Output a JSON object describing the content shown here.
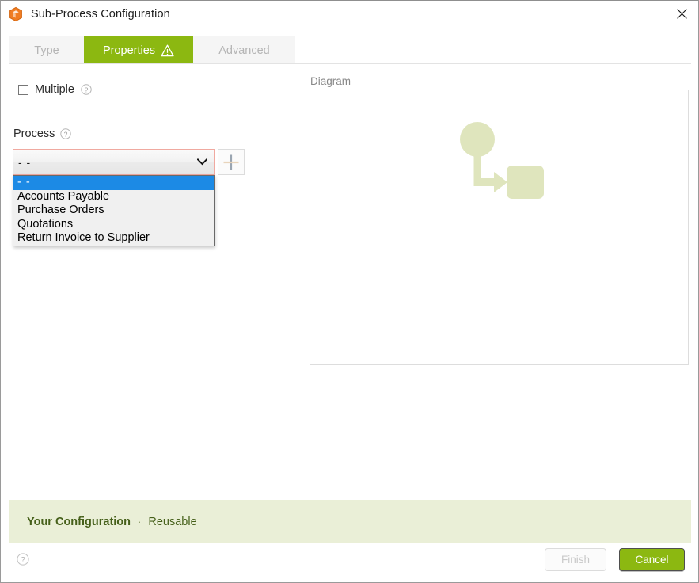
{
  "window": {
    "title": "Sub-Process Configuration",
    "app_icon": "orange-cube-icon",
    "close_icon": "close-icon"
  },
  "tabs": [
    {
      "label": "Type",
      "active": false
    },
    {
      "label": "Properties",
      "active": true,
      "badge_icon": "warning-triangle-icon"
    },
    {
      "label": "Advanced",
      "active": false
    }
  ],
  "form": {
    "multiple": {
      "label": "Multiple",
      "checked": false,
      "help_icon": "help-circle-icon"
    },
    "process": {
      "label": "Process",
      "help_icon": "help-circle-icon",
      "selected_value": "- -",
      "invalid": true,
      "chevron_icon": "chevron-down-icon",
      "add_button_icon": "plus-icon",
      "options": [
        "- -",
        "Accounts Payable",
        "Purchase Orders",
        "Quotations",
        "Return Invoice to Supplier"
      ],
      "highlighted_option": "- -"
    }
  },
  "diagram": {
    "label": "Diagram",
    "shape_color": "#dfe5bd",
    "nodes": [
      {
        "name": "start-event-circle",
        "type": "circle"
      },
      {
        "name": "task-rounded-rect",
        "type": "rounded-rect"
      }
    ],
    "connector": {
      "name": "elbow-arrow-connector",
      "type": "elbow-arrow"
    }
  },
  "config_banner": {
    "title": "Your Configuration",
    "separator": "·",
    "subtitle": "Reusable",
    "background": "#eaefd7",
    "text_color": "#46601a"
  },
  "footer": {
    "help_icon": "help-circle-icon",
    "finish_label": "Finish",
    "finish_enabled": false,
    "cancel_label": "Cancel",
    "cancel_color": "#8cb811"
  }
}
